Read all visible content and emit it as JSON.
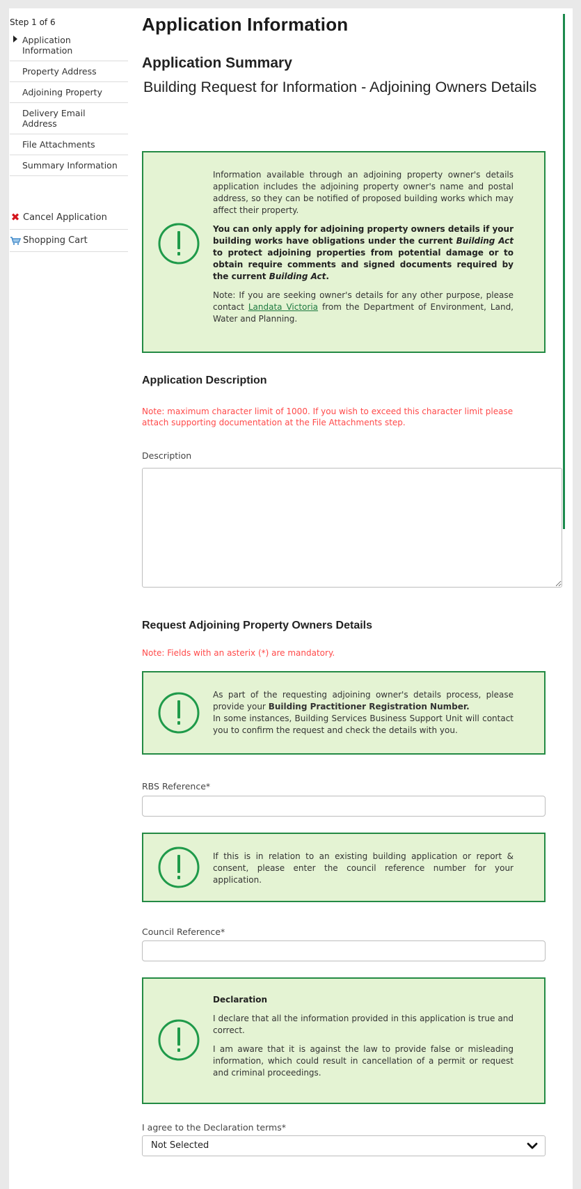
{
  "sidebar": {
    "step": "Step 1 of 6",
    "items": [
      {
        "label": "Application Information"
      },
      {
        "label": "Property Address"
      },
      {
        "label": "Adjoining Property"
      },
      {
        "label": "Delivery Email Address"
      },
      {
        "label": "File Attachments"
      },
      {
        "label": "Summary Information"
      }
    ],
    "actions": {
      "cancel": "Cancel Application",
      "cart": "Shopping Cart"
    }
  },
  "main": {
    "title": "Application Information",
    "summary_heading": "Application Summary",
    "summary_subtitle": "Building Request for Information - Adjoining Owners Details",
    "info1": {
      "p1": "Information available through an adjoining property owner's details application includes the adjoining property owner's name and postal address, so they can be notified of proposed building works which may affect their property.",
      "p2_a": "You can only apply for adjoining property owners details if your building works have obligations under the current ",
      "p2_act1": "Building Act",
      "p2_b": " to protect adjoining properties from potential damage or to obtain require comments and signed documents required by the current ",
      "p2_act2": "Building Act",
      "p2_end": ".",
      "p3_a": "Note: If you are seeking owner's details for any other purpose, please contact ",
      "p3_link": "Landata Victoria",
      "p3_b": " from the Department of Environment, Land, Water and Planning."
    },
    "description_section": {
      "heading": "Application Description",
      "note": "Note: maximum character limit of 1000. If you wish to exceed this character limit please attach supporting documentation at the File Attachments step.",
      "label": "Description",
      "value": ""
    },
    "request_section": {
      "heading": "Request Adjoining Property Owners Details",
      "note": "Note: Fields with an asterix (*) are mandatory."
    },
    "info2": {
      "a": "As part of the requesting adjoining owner's details process, please provide your ",
      "strong": "Building Practitioner Registration Number.",
      "b": "In some instances, Building Services Business Support Unit will contact you to confirm the request and check the details with you."
    },
    "rbs": {
      "label": "RBS Reference*",
      "value": ""
    },
    "info3": {
      "text": "If this is in relation to an existing building application or report & consent, please enter the council reference number for your application."
    },
    "council": {
      "label": "Council Reference*",
      "value": ""
    },
    "declaration": {
      "heading": "Declaration",
      "p1": "I declare that all the information provided in this application is true and correct.",
      "p2": "I am aware that it is against the law to provide false or misleading information, which could result in cancellation of a permit or request and criminal proceedings."
    },
    "agree": {
      "label": "I agree to the Declaration terms*",
      "selected": "Not Selected"
    }
  },
  "colors": {
    "accent_green": "#238a44",
    "box_bg": "#e4f3d3",
    "note_red": "#ff4a4a",
    "cancel_red": "#d4141c"
  },
  "icons": [
    "caret-right-icon",
    "close-icon",
    "shopping-cart-icon",
    "exclamation-circle-icon",
    "chevron-down-icon"
  ]
}
